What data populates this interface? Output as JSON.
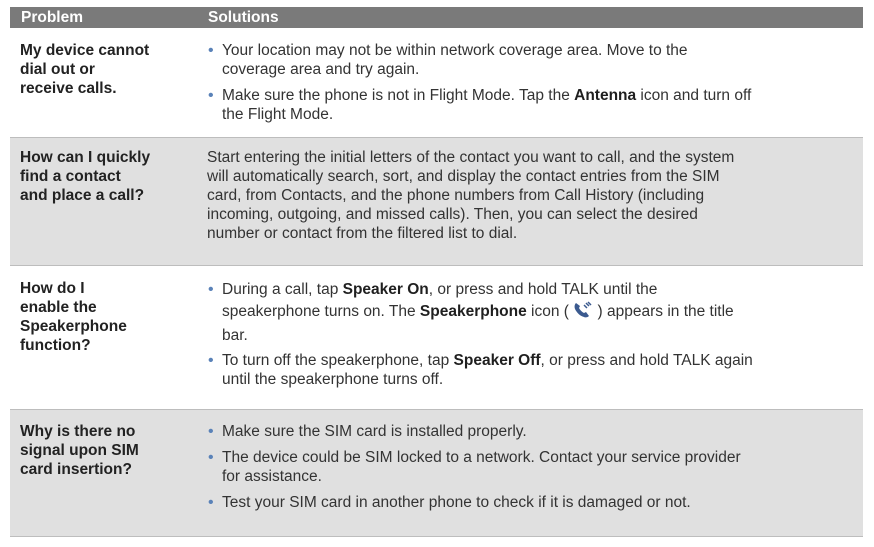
{
  "header": {
    "problem": "Problem",
    "solutions": "Solutions"
  },
  "rows": [
    {
      "problem": [
        "My device cannot",
        "dial out or",
        "receive calls."
      ],
      "b1": {
        "lines": [
          "Your location may not be within network coverage area. Move to the",
          "coverage area and try again."
        ]
      },
      "b2": {
        "pre": "Make sure the phone is not in Flight Mode. Tap the ",
        "bold": "Antenna",
        "post": " icon and turn off",
        "line2": "the Flight Mode."
      }
    },
    {
      "problem": [
        "How can I quickly",
        "find a contact",
        "and place a call?"
      ],
      "lines": [
        "Start entering the initial letters of the contact you want to call, and the system",
        "will automatically search, sort, and display the contact entries from the SIM",
        "card, from Contacts, and the phone numbers from Call History (including",
        "incoming, outgoing, and missed calls). Then, you can select the desired",
        "number or contact from the filtered list to dial."
      ]
    },
    {
      "problem": [
        "How do I",
        "enable the",
        "Speakerphone",
        "function?"
      ],
      "b1": {
        "pre": "During a call, tap ",
        "bold": "Speaker On",
        "post": ", or press and hold TALK until the",
        "line2pre": "speakerphone turns on. The ",
        "line2bold": "Speakerphone",
        "line2mid": " icon ( ",
        "line2post": " ) appears in the title",
        "line3": "bar."
      },
      "b2": {
        "pre": "To turn off the speakerphone, tap ",
        "bold": "Speaker Off",
        "post": ", or press and hold TALK again",
        "line2": "until the speakerphone turns off."
      }
    },
    {
      "problem": [
        "Why is there no",
        "signal upon SIM",
        "card insertion?"
      ],
      "b1": "Make sure the SIM card is installed properly.",
      "b2": {
        "lines": [
          "The device could be SIM locked to a network. Contact your service provider",
          "for assistance."
        ]
      },
      "b3": "Test your SIM card in another phone to check if it is damaged or not."
    }
  ],
  "icons": {
    "speakerphone": "speakerphone-icon",
    "bullet": "bullet-dot"
  },
  "colors": {
    "header_bg": "#7a7a7a",
    "alt_row_bg": "#e0e0e0",
    "bullet": "#5a82b8"
  }
}
